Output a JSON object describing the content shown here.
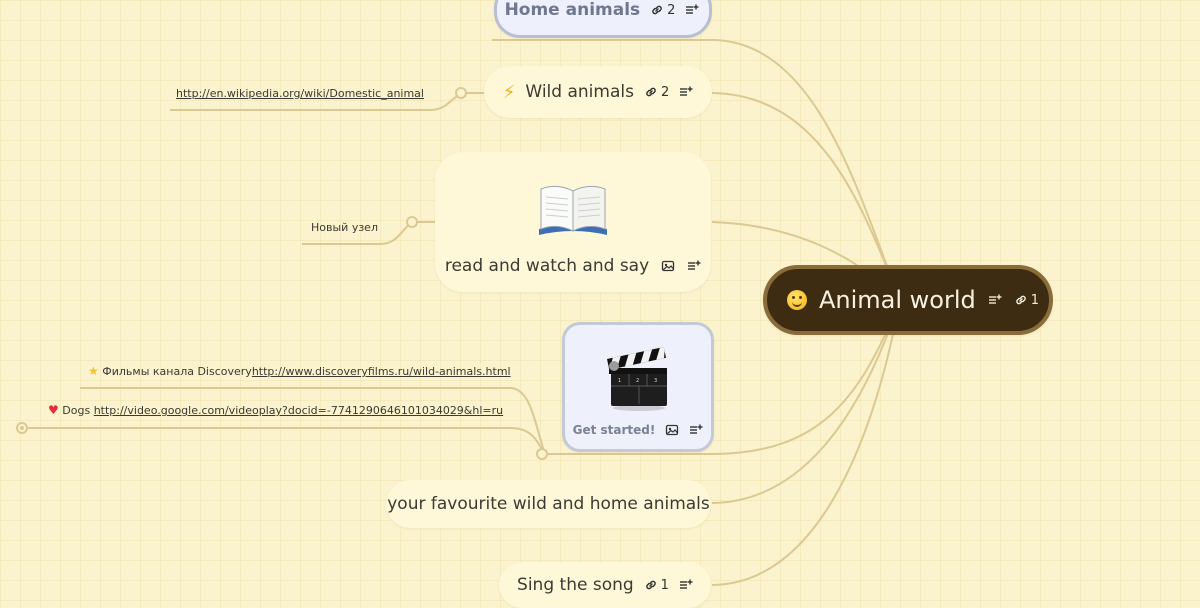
{
  "root": {
    "label": "Animal world",
    "link_count": "1"
  },
  "nodes": {
    "home": {
      "label": "Home animals",
      "link_count": "2"
    },
    "wild": {
      "label": "Wild animals",
      "link_count": "2"
    },
    "read": {
      "label": "read and watch and say"
    },
    "getstarted": {
      "label": "Get started!"
    },
    "fav": {
      "label": "your favourite wild and home animals"
    },
    "sing": {
      "label": "Sing the song",
      "link_count": "1"
    }
  },
  "subnodes": {
    "wiki_link": "http://en.wikipedia.org/wiki/Domestic_animal",
    "new_node": "Новый узел",
    "discovery_text": "Фильмы канала Discovery",
    "discovery_link": "http://www.discoveryfilms.ru/wild-animals.html",
    "dogs_text": "Dogs",
    "dogs_link": "http://video.google.com/videoplay?docid=-7741290646101034029&hl=ru"
  },
  "colors": {
    "background": "#fbf3cd",
    "root_fill": "#3e2c12",
    "root_border": "#8a6b3a",
    "connector": "#dcc893"
  },
  "icons": [
    "smiley-icon",
    "lightning-icon",
    "link-icon",
    "notes-icon",
    "image-icon",
    "book-icon",
    "clapperboard-icon",
    "star-icon",
    "heart-icon"
  ]
}
